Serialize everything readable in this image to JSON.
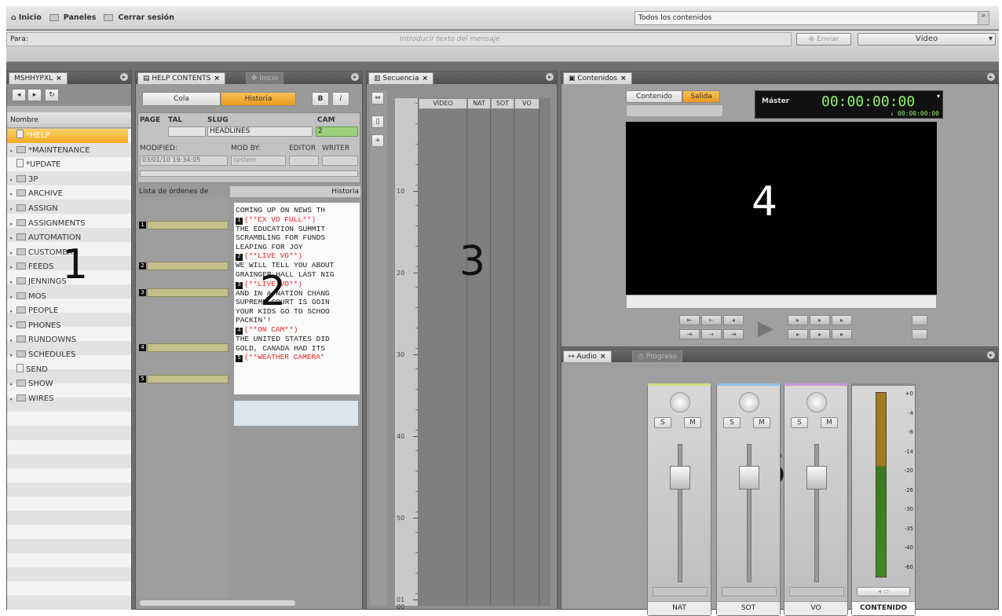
{
  "topbar": {
    "home": "Inicio",
    "panels": "Paneles",
    "logout": "Cerrar sesión",
    "search_scope": "Todos los contenidos"
  },
  "message_bar": {
    "to_label": "Para:",
    "placeholder": "Introducir texto del mensaje",
    "send": "Enviar",
    "media": "Vídeo"
  },
  "panel1": {
    "tab": "MSHHYPXL",
    "column": "Nombre",
    "callout": "1",
    "items": [
      {
        "label": "*HELP",
        "type": "file",
        "selected": true
      },
      {
        "label": "*MAINTENANCE",
        "type": "folder"
      },
      {
        "label": "*UPDATE",
        "type": "file"
      },
      {
        "label": "3P",
        "type": "folder"
      },
      {
        "label": "ARCHIVE",
        "type": "folder"
      },
      {
        "label": "ASSIGN",
        "type": "folder"
      },
      {
        "label": "ASSIGNMENTS",
        "type": "folder"
      },
      {
        "label": "AUTOMATION",
        "type": "folder"
      },
      {
        "label": "CUSTOMERS",
        "type": "folder"
      },
      {
        "label": "FEEDS",
        "type": "folder"
      },
      {
        "label": "JENNINGS",
        "type": "folder"
      },
      {
        "label": "MOS",
        "type": "folder"
      },
      {
        "label": "PEOPLE",
        "type": "folder"
      },
      {
        "label": "PHONES",
        "type": "folder"
      },
      {
        "label": "RUNDOWNS",
        "type": "folder"
      },
      {
        "label": "SCHEDULES",
        "type": "folder"
      },
      {
        "label": "SEND",
        "type": "file"
      },
      {
        "label": "SHOW",
        "type": "folder"
      },
      {
        "label": "WIRES",
        "type": "folder"
      }
    ]
  },
  "panel2": {
    "tab": "HELP CONTENTS",
    "tab2": "Inicio",
    "cola": "Cola",
    "historia": "Historia",
    "bold": "B",
    "italic": "I",
    "page": "PAGE",
    "tal": "TAL",
    "slug": "SLUG",
    "cam": "CAM",
    "slug_value": "HEADLINES",
    "cam_value": "2",
    "modified": "MODIFIED:",
    "mod_by": "MOD BY:",
    "editor": "EDITOR",
    "writer": "WRITER",
    "date": "03/01/10 19:34:05",
    "mod_by_value": "system",
    "list_label": "Lista de órdenes de",
    "history_label": "Historia",
    "callout": "2",
    "script": [
      {
        "text": "COMING UP ON NEWS TH",
        "cue": false
      },
      {
        "text": "(**EX VO FULL**)",
        "cue": true,
        "num": "1"
      },
      {
        "text": "THE EDUCATION SUMMIT",
        "cue": false
      },
      {
        "text": "SCRAMBLING FOR FUNDS",
        "cue": false
      },
      {
        "text": "LEAPING FOR JOY",
        "cue": false
      },
      {
        "text": "(**LIVE VO**)",
        "cue": true,
        "num": "2"
      },
      {
        "text": "WE WILL TELL YOU ABOUT",
        "cue": false
      },
      {
        "text": "GRAINGER HALL LAST NIG",
        "cue": false
      },
      {
        "text": "(**LIVE VO**)",
        "cue": true,
        "num": "3"
      },
      {
        "text": "AND IN A NATION CHANG",
        "cue": false
      },
      {
        "text": "SUPREME COURT IS GOIN",
        "cue": false
      },
      {
        "text": "YOUR KIDS GO TO SCHOO",
        "cue": false
      },
      {
        "text": "PACKIN'!",
        "cue": false
      },
      {
        "text": "(**ON CAM**)",
        "cue": true,
        "num": "4"
      },
      {
        "text": "THE UNITED STATES DID",
        "cue": false
      },
      {
        "text": "GOLD, CANADA HAD ITS",
        "cue": false
      },
      {
        "text": "(**WEATHER CAMERA*",
        "cue": true,
        "num": "5"
      }
    ]
  },
  "panel3": {
    "tab": "Secuencia",
    "tracks": [
      "VÍDEO",
      "NAT",
      "SOT",
      "VO"
    ],
    "ticks": [
      "10",
      "20",
      "30",
      "40",
      "50",
      "01\n00"
    ],
    "callout": "3"
  },
  "panel4": {
    "tab": "Contenidos",
    "contenido": "Contenido",
    "salida": "Salida",
    "master": "Máster",
    "timecode": "00:00:00:00",
    "timecode_small": "00:00:00:00",
    "callout": "4"
  },
  "panel5": {
    "tab": "Audio",
    "tab2": "Progreso",
    "channels": [
      "NAT",
      "SOT",
      "VO"
    ],
    "solo": "S",
    "mute": "M",
    "master": "CONTENIDO",
    "meter_scale": [
      "+0",
      "-4",
      "-8",
      "-14",
      "-20",
      "-26",
      "-30",
      "-35",
      "-40",
      "-60"
    ],
    "callout": "5"
  }
}
